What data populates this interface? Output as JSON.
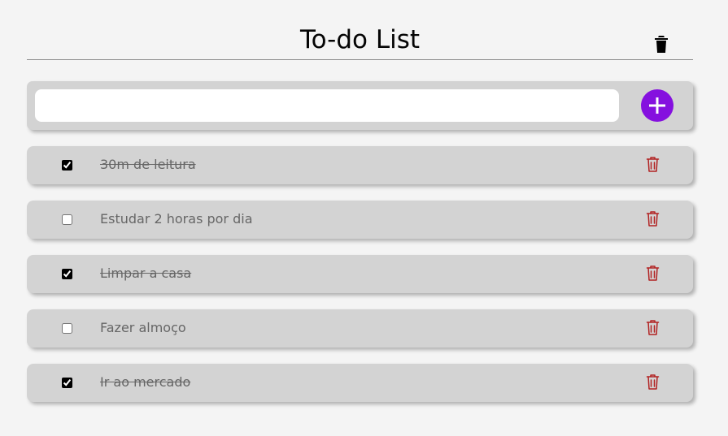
{
  "header": {
    "title": "To-do List",
    "clear_icon": "trash-icon"
  },
  "composer": {
    "input_value": "",
    "add_icon": "plus-icon"
  },
  "tasks": [
    {
      "label": "30m de leitura",
      "done": true
    },
    {
      "label": "Estudar 2 horas por dia",
      "done": false
    },
    {
      "label": "Limpar a casa",
      "done": true
    },
    {
      "label": "Fazer almoço",
      "done": false
    },
    {
      "label": "Ir ao mercado",
      "done": true
    }
  ],
  "colors": {
    "accent": "#8510df",
    "delete": "#b22222",
    "panel": "#d3d3d3",
    "background": "#f4f4f4"
  }
}
